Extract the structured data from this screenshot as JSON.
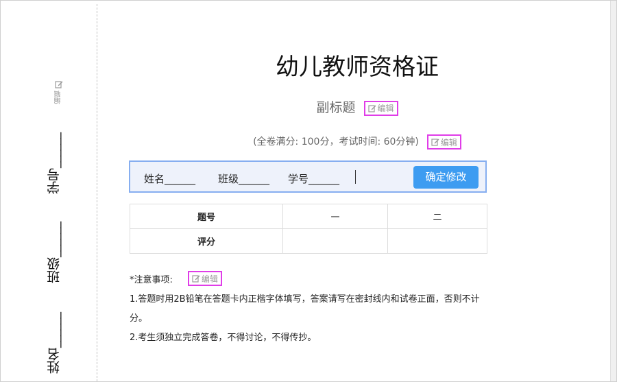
{
  "side": {
    "edit_label": "编辑",
    "fields": [
      {
        "label": "学号",
        "blank": "______"
      },
      {
        "label": "班级",
        "blank": "______"
      },
      {
        "label": "姓名",
        "blank": "______"
      }
    ]
  },
  "header": {
    "title": "幼儿教师资格证",
    "subtitle": "副标题",
    "subtitle_edit": "编辑",
    "info": "(全卷满分: 100分，考试时间: 60分钟)",
    "info_edit": "编辑"
  },
  "student_bar": {
    "name": "姓名______",
    "class": "班级______",
    "id": "学号______",
    "confirm_label": "确定修改"
  },
  "score_table": {
    "header_label": "题号",
    "columns": [
      "一",
      "二"
    ],
    "score_label": "评分",
    "scores": [
      "",
      ""
    ]
  },
  "notes": {
    "heading": "*注意事项:",
    "edit_label": "编辑",
    "items": [
      "1.答题时用2B铅笔在答题卡内正楷字体填写，答案请写在密封线内和试卷正面，否则不计分。",
      "2.考生须独立完成答卷，不得讨论，不得传抄。"
    ]
  },
  "colors": {
    "accent_button": "#3d9cf1",
    "highlight_border": "#e03de8",
    "student_bar_bg": "#eef2fb",
    "student_bar_border": "#86aef0"
  }
}
